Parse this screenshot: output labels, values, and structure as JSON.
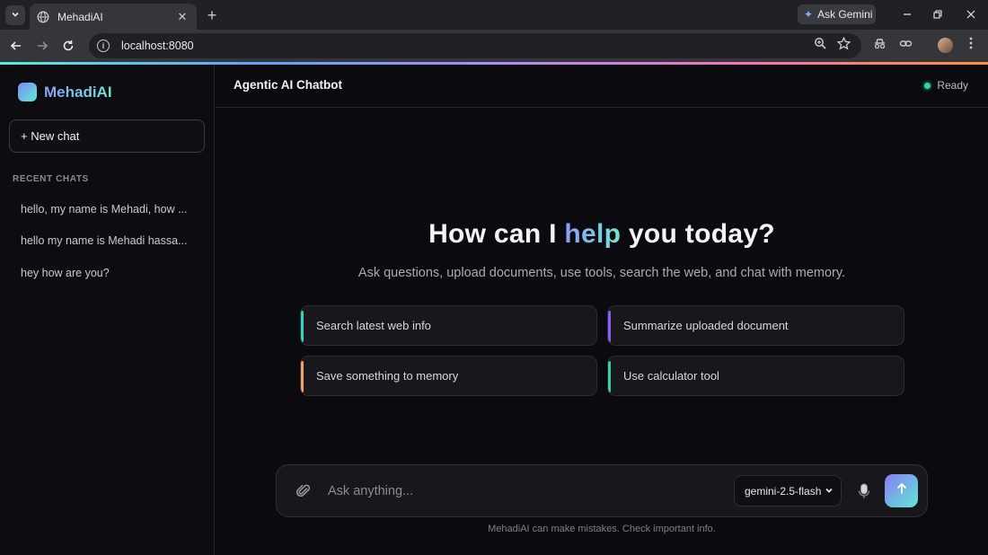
{
  "browser": {
    "tab_title": "MehadiAI",
    "url": "localhost:8080",
    "ask_gemini_label": "Ask Gemini",
    "new_tab_symbol": "+",
    "close_symbol": "✕"
  },
  "sidebar": {
    "brand": "MehadiAI",
    "new_chat_label": "+ New chat",
    "recent_label": "RECENT CHATS",
    "recent_chats": [
      {
        "label": "hello, my name is Mehadi, how ..."
      },
      {
        "label": "hello my name is Mehadi hassa..."
      },
      {
        "label": "hey how are you?"
      }
    ]
  },
  "header": {
    "title": "Agentic AI Chatbot",
    "status": "Ready",
    "status_color": "#34d399"
  },
  "hero": {
    "title_before": "How can I ",
    "title_highlight": "help",
    "title_after": " you today?",
    "subtitle": "Ask questions, upload documents, use tools, search the web, and chat with memory."
  },
  "suggestions": [
    {
      "label": "Search latest web info",
      "accent": "#2dd4bf"
    },
    {
      "label": "Summarize uploaded document",
      "accent": "#8b5cf6"
    },
    {
      "label": "Save something to memory",
      "accent": "#f59e63"
    },
    {
      "label": "Use calculator tool",
      "accent": "#34d399"
    }
  ],
  "composer": {
    "placeholder": "Ask anything...",
    "model": "gemini-2.5-flash",
    "send_icon": "arrow-up-icon"
  },
  "footer": {
    "disclaimer": "MehadiAI can make mistakes. Check important info."
  }
}
